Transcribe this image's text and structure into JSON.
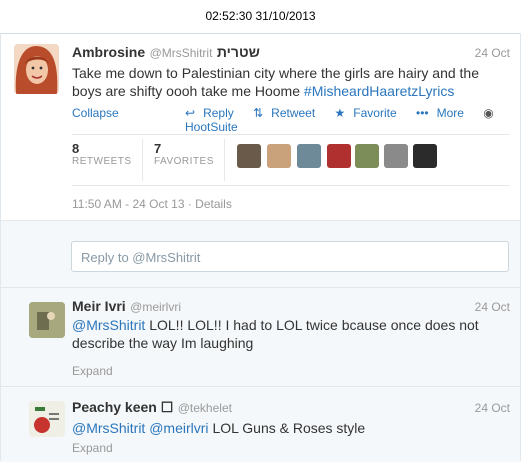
{
  "status_bar": {
    "datetime": "02:52:30 31/10/2013"
  },
  "main_tweet": {
    "fullname": "Ambrosine",
    "username": "@MrsShitrit",
    "name_hebrew": "שטרית",
    "time": "24 Oct",
    "text_plain": "Take me down to Palestinian city where the girls are hairy and the boys are shifty oooh take me Hoome",
    "hashtag": "#MisheardHaaretzLyrics",
    "collapse": "Collapse",
    "actions": {
      "reply": "Reply",
      "retweet": "Retweet",
      "favorite": "Favorite",
      "more": "More",
      "hootsuite": "HootSuite"
    },
    "stats": {
      "retweets_count": "8",
      "retweets_label": "RETWEETS",
      "favorites_count": "7",
      "favorites_label": "FAVORITES"
    },
    "details": "11:50 AM - 24 Oct 13 · Details",
    "icons": {
      "reply": "reply-icon",
      "retweet": "retweet-icon",
      "favorite": "star-icon",
      "more": "dots-icon",
      "hootsuite": "hootsuite-icon"
    }
  },
  "reply_box": {
    "placeholder": "Reply to @MrsShitrit"
  },
  "replies": [
    {
      "fullname": "Meir Ivri",
      "username": "@meirlvri",
      "time": "24 Oct",
      "mention": "@MrsShitrit",
      "text": "LOL!! LOL!! I had to LOL twice bcause once does not describe the way Im laughing",
      "expand": "Expand"
    },
    {
      "fullname": "Peachy keen ☐",
      "username": "@tekhelet",
      "time": "24 Oct",
      "mention1": "@MrsShitrit",
      "mention2": "@meirlvri",
      "text": "LOL Guns & Roses style",
      "expand": "Expand"
    }
  ],
  "colors": {
    "link": "#2a76bd",
    "muted": "#999999",
    "text": "#333333",
    "reply_bg": "#f5f8fa"
  }
}
